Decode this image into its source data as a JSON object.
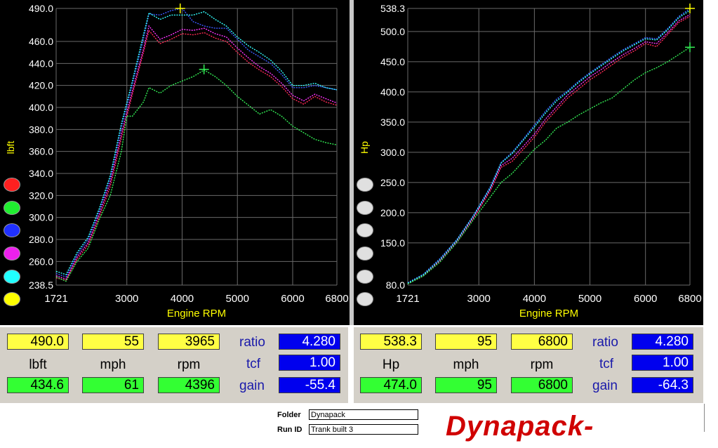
{
  "colors": {
    "red": "#ff2a55",
    "green": "#33ee55",
    "blue": "#3b5bff",
    "magenta": "#ff33ff",
    "cyan": "#33ffff",
    "yellow": "#ffff00",
    "grid": "#6a6a6a",
    "axis_label": "#ffff00"
  },
  "chart_data": [
    {
      "type": "line",
      "xlabel": "Engine RPM",
      "ylabel": "lbft",
      "xlim": [
        1721,
        6800
      ],
      "ylim": [
        238.5,
        490.0
      ],
      "x_ticks": [
        "1721",
        "3000",
        "4000",
        "5000",
        "6000",
        "6800"
      ],
      "y_ticks": [
        "490.0",
        "460.0",
        "440.0",
        "420.0",
        "400.0",
        "380.0",
        "360.0",
        "340.0",
        "320.0",
        "300.0",
        "280.0",
        "260.0",
        "238.5"
      ],
      "grid": true,
      "series": [
        {
          "color": "red",
          "x": [
            1721,
            1900,
            2100,
            2300,
            2500,
            2700,
            2900,
            3100,
            3300,
            3400,
            3600,
            3800,
            4000,
            4200,
            4400,
            4600,
            4800,
            5000,
            5200,
            5400,
            5600,
            5800,
            6000,
            6200,
            6400,
            6600,
            6800
          ],
          "y": [
            245,
            243,
            262,
            275,
            300,
            328,
            372,
            412,
            450,
            470,
            458,
            462,
            467,
            466,
            468,
            463,
            460,
            450,
            441,
            434,
            428,
            419,
            408,
            403,
            410,
            405,
            402
          ]
        },
        {
          "color": "magenta",
          "x": [
            1721,
            1900,
            2100,
            2300,
            2500,
            2700,
            2900,
            3100,
            3300,
            3400,
            3600,
            3800,
            4000,
            4200,
            4400,
            4600,
            4800,
            5000,
            5200,
            5400,
            5600,
            5800,
            6000,
            6200,
            6400,
            6600,
            6800
          ],
          "y": [
            247,
            244,
            264,
            277,
            303,
            332,
            376,
            415,
            453,
            474,
            462,
            466,
            471,
            470,
            472,
            467,
            464,
            454,
            445,
            437,
            431,
            422,
            411,
            406,
            412,
            408,
            404
          ]
        },
        {
          "color": "blue",
          "x": [
            1721,
            1900,
            2100,
            2300,
            2500,
            2700,
            2900,
            3100,
            3300,
            3400,
            3600,
            3800,
            4000,
            4200,
            4400,
            4600,
            4800,
            5000,
            5200,
            5400,
            5600,
            5800,
            6000,
            6200,
            6400,
            6600,
            6800
          ],
          "y": [
            249,
            246,
            266,
            280,
            306,
            336,
            382,
            421,
            462,
            485,
            484,
            488,
            490,
            478,
            474,
            472,
            472,
            462,
            452,
            446,
            440,
            430,
            418,
            418,
            420,
            418,
            416
          ]
        },
        {
          "color": "cyan",
          "x": [
            1721,
            1900,
            2100,
            2300,
            2500,
            2700,
            2900,
            3100,
            3300,
            3400,
            3600,
            3800,
            4000,
            4200,
            4400,
            4600,
            4800,
            5000,
            5200,
            5400,
            5600,
            5800,
            6000,
            6200,
            6400,
            6600,
            6800
          ],
          "y": [
            251,
            248,
            268,
            282,
            308,
            338,
            385,
            424,
            466,
            486,
            480,
            484,
            484,
            484,
            487,
            480,
            474,
            464,
            456,
            450,
            443,
            433,
            420,
            420,
            422,
            418,
            416
          ]
        },
        {
          "color": "green",
          "x": [
            1721,
            1900,
            2100,
            2300,
            2500,
            2700,
            2900,
            3000,
            3100,
            3300,
            3400,
            3600,
            3800,
            4000,
            4200,
            4400,
            4600,
            4800,
            5000,
            5200,
            5400,
            5600,
            5800,
            6000,
            6200,
            6400,
            6600,
            6800
          ],
          "y": [
            246,
            242,
            260,
            272,
            298,
            320,
            360,
            392,
            392,
            405,
            418,
            413,
            420,
            424,
            428,
            434,
            428,
            420,
            410,
            402,
            394,
            398,
            392,
            383,
            377,
            371,
            368,
            366
          ]
        }
      ],
      "cursor_markers": [
        {
          "color": "yellow",
          "x": 3965,
          "y": 490.0
        },
        {
          "color": "green",
          "x": 4396,
          "y": 434.6
        }
      ]
    },
    {
      "type": "line",
      "xlabel": "Engine RPM",
      "ylabel": "Hp",
      "xlim": [
        1721,
        6800
      ],
      "ylim": [
        80.0,
        538.3
      ],
      "x_ticks": [
        "1721",
        "3000",
        "4000",
        "5000",
        "6000",
        "6800"
      ],
      "y_ticks": [
        "538.3",
        "500.0",
        "450.0",
        "400.0",
        "350.0",
        "300.0",
        "250.0",
        "200.0",
        "150.0",
        "80.0"
      ],
      "grid": true,
      "series": [
        {
          "color": "red",
          "x": [
            1721,
            2000,
            2300,
            2600,
            2900,
            3200,
            3400,
            3600,
            3800,
            4000,
            4200,
            4400,
            4600,
            4800,
            5000,
            5200,
            5400,
            5600,
            5800,
            6000,
            6200,
            6400,
            6600,
            6800
          ],
          "y": [
            82,
            95,
            120,
            150,
            190,
            235,
            275,
            285,
            305,
            325,
            350,
            370,
            390,
            405,
            420,
            432,
            445,
            458,
            468,
            480,
            475,
            495,
            515,
            525
          ]
        },
        {
          "color": "magenta",
          "x": [
            1721,
            2000,
            2300,
            2600,
            2900,
            3200,
            3400,
            3600,
            3800,
            4000,
            4200,
            4400,
            4600,
            4800,
            5000,
            5200,
            5400,
            5600,
            5800,
            6000,
            6200,
            6400,
            6600,
            6800
          ],
          "y": [
            83,
            96,
            121,
            152,
            192,
            238,
            278,
            290,
            310,
            330,
            355,
            375,
            395,
            410,
            425,
            437,
            450,
            462,
            472,
            483,
            480,
            498,
            518,
            528
          ]
        },
        {
          "color": "blue",
          "x": [
            1721,
            2000,
            2300,
            2600,
            2900,
            3200,
            3400,
            3600,
            3800,
            4000,
            4200,
            4400,
            4600,
            4800,
            5000,
            5200,
            5400,
            5600,
            5800,
            6000,
            6200,
            6400,
            6600,
            6800
          ],
          "y": [
            84,
            98,
            124,
            155,
            195,
            242,
            283,
            300,
            322,
            345,
            368,
            388,
            402,
            418,
            432,
            445,
            458,
            470,
            480,
            490,
            488,
            505,
            525,
            538
          ]
        },
        {
          "color": "cyan",
          "x": [
            1721,
            2000,
            2300,
            2600,
            2900,
            3200,
            3400,
            3600,
            3800,
            4000,
            4200,
            4400,
            4600,
            4800,
            5000,
            5200,
            5400,
            5600,
            5800,
            6000,
            6200,
            6400,
            6600,
            6800
          ],
          "y": [
            83,
            97,
            122,
            154,
            194,
            240,
            282,
            298,
            320,
            342,
            365,
            385,
            400,
            416,
            430,
            443,
            456,
            468,
            478,
            488,
            486,
            503,
            523,
            535
          ]
        },
        {
          "color": "green",
          "x": [
            1721,
            2000,
            2300,
            2600,
            2900,
            3200,
            3400,
            3600,
            3800,
            4000,
            4200,
            4400,
            4600,
            4800,
            5000,
            5200,
            5400,
            5600,
            5800,
            6000,
            6200,
            6400,
            6600,
            6800
          ],
          "y": [
            82,
            95,
            118,
            150,
            188,
            225,
            250,
            265,
            285,
            305,
            320,
            340,
            350,
            362,
            372,
            382,
            390,
            405,
            420,
            432,
            440,
            450,
            462,
            474
          ]
        }
      ],
      "cursor_markers": [
        {
          "color": "yellow",
          "x": 6800,
          "y": 538.3
        },
        {
          "color": "green",
          "x": 6800,
          "y": 474.0
        }
      ]
    }
  ],
  "left_readout": {
    "row1": [
      "490.0",
      "55",
      "3965"
    ],
    "labels": [
      "lbft",
      "mph",
      "rpm"
    ],
    "row3": [
      "434.6",
      "61",
      "4396"
    ],
    "ratio_label": "ratio",
    "ratio": "4.280",
    "tcf_label": "tcf",
    "tcf": "1.00",
    "gain_label": "gain",
    "gain": "-55.4"
  },
  "right_readout": {
    "row1": [
      "538.3",
      "95",
      "6800"
    ],
    "labels": [
      "Hp",
      "mph",
      "rpm"
    ],
    "row3": [
      "474.0",
      "95",
      "6800"
    ],
    "ratio_label": "ratio",
    "ratio": "4.280",
    "tcf_label": "tcf",
    "tcf": "1.00",
    "gain_label": "gain",
    "gain": "-64.3"
  },
  "footer": {
    "folder_label": "Folder",
    "folder_value": "Dynapack",
    "runid_label": "Run ID",
    "runid_value": "Trank  built  3",
    "logo_text": "Dynapack-"
  }
}
